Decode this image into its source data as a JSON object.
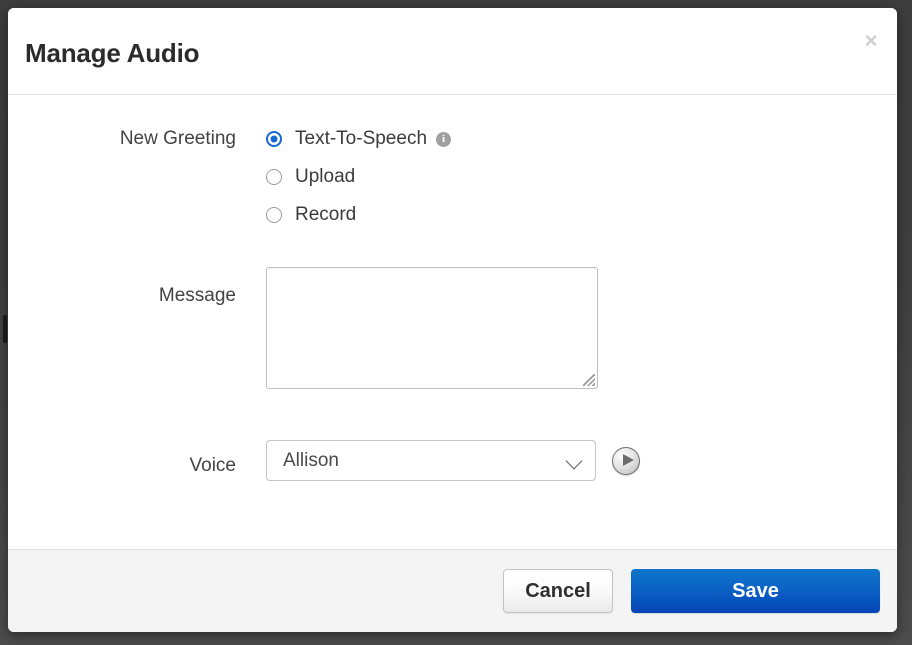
{
  "dialog": {
    "title": "Manage Audio",
    "close_label": "×"
  },
  "form": {
    "greeting": {
      "label": "New Greeting",
      "info_icon_glyph": "i",
      "options": [
        {
          "label": "Text-To-Speech",
          "selected": true,
          "has_info": true
        },
        {
          "label": "Upload",
          "selected": false,
          "has_info": false
        },
        {
          "label": "Record",
          "selected": false,
          "has_info": false
        }
      ]
    },
    "message": {
      "label": "Message",
      "value": "",
      "placeholder": ""
    },
    "voice": {
      "label": "Voice",
      "selected": "Allison",
      "play_button_name": "play-icon"
    }
  },
  "footer": {
    "cancel_label": "Cancel",
    "save_label": "Save"
  },
  "colors": {
    "accent_blue": "#1668d6",
    "save_button_top": "#0e76cb",
    "save_button_bottom": "#0445b6",
    "backdrop": "#3f3f3f",
    "footer_bg": "#f4f4f4",
    "info_icon_gray": "#a0a0a0"
  }
}
